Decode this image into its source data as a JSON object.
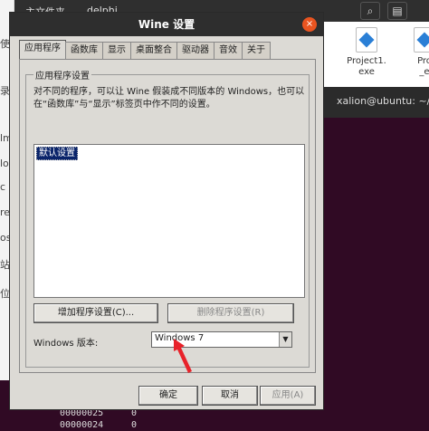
{
  "background": {
    "top_left_text": "主文件夹",
    "top_tab_text": "delphi",
    "top_button_1": "⌕",
    "top_button_2": "▤",
    "left_sidebar_chars": [
      "使",
      "录",
      "lm",
      "lo",
      "c",
      "re",
      "os",
      "站",
      "位"
    ],
    "files": [
      {
        "name_line1": "P.",
        "name_line2": ""
      },
      {
        "name_line1": "Project1.",
        "name_line2": "exe"
      },
      {
        "name_line1": "Pro",
        "name_line2": "_e"
      }
    ],
    "terminal_header": "xalion@ubuntu: ~/d",
    "terminal_rows": [
      {
        "addr": "00000025",
        "val": "0"
      },
      {
        "addr": "00000024",
        "val": "0"
      }
    ]
  },
  "dialog": {
    "title": "Wine 设置",
    "close_glyph": "×",
    "tabs": [
      "应用程序",
      "函数库",
      "显示",
      "桌面整合",
      "驱动器",
      "音效",
      "关于"
    ],
    "active_tab_index": 0,
    "group_label": "应用程序设置",
    "description": "对不同的程序，可以让 Wine 假装成不同版本的 Windows，也可以在“函数库”与“显示”标签页中作不同的设置。",
    "list_items": [
      "默认设置"
    ],
    "add_button": "增加程序设置(C)...",
    "remove_button": "删除程序设置(R)",
    "version_label": "Windows 版本:",
    "version_value": "Windows 7",
    "ok_button": "确定",
    "cancel_button": "取消",
    "apply_button": "应用(A)"
  },
  "colors": {
    "selection": "#0a246a",
    "close_button": "#e95420",
    "terminal_bg": "#300a24",
    "annotation_arrow": "#e8222a"
  }
}
